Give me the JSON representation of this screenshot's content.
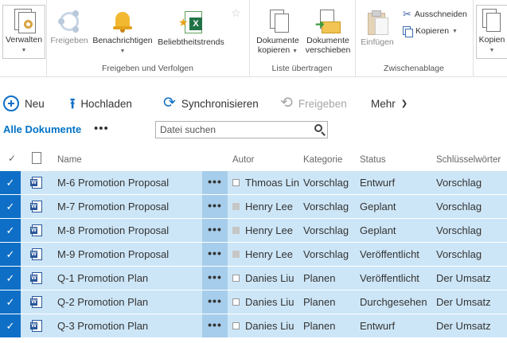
{
  "ribbon": {
    "manage": {
      "label": "Verwalten"
    },
    "share_group": {
      "label": "Freigeben und Verfolgen",
      "share": "Freigeben",
      "alerts": "Benachrichtigen",
      "trends": "Beliebtheitstrends"
    },
    "copy_group": {
      "label": "Liste übertragen",
      "copy_docs_1": "Dokumente",
      "copy_docs_2": "kopieren",
      "move_docs_1": "Dokumente",
      "move_docs_2": "verschieben"
    },
    "clipboard_group": {
      "label": "Zwischenablage",
      "paste": "Einfügen",
      "cut": "Ausschneiden",
      "copy": "Kopieren"
    },
    "copies": "Kopien"
  },
  "commands": {
    "new": "Neu",
    "upload": "Hochladen",
    "sync": "Synchronisieren",
    "share": "Freigeben",
    "more": "Mehr"
  },
  "view": {
    "name": "Alle Dokumente",
    "more": "•••",
    "search_placeholder": "Datei suchen"
  },
  "table": {
    "columns": {
      "name": "Name",
      "author": "Autor",
      "category": "Kategorie",
      "status": "Status",
      "keywords": "Schlüsselwörter"
    },
    "rows": [
      {
        "name": "M-6 Promotion Proposal",
        "author": "Thmoas Lin",
        "presence": "empty",
        "category": "Vorschlag",
        "status": "Entwurf",
        "keywords": "Vorschlag"
      },
      {
        "name": "M-7 Promotion Proposal",
        "author": "Henry Lee",
        "presence": "grey",
        "category": "Vorschlag",
        "status": "Geplant",
        "keywords": "Vorschlag"
      },
      {
        "name": "M-8 Promotion Proposal",
        "author": "Henry Lee",
        "presence": "grey",
        "category": "Vorschlag",
        "status": "Geplant",
        "keywords": "Vorschlag"
      },
      {
        "name": "M-9 Promotion Proposal",
        "author": "Henry Lee",
        "presence": "grey",
        "category": "Vorschlag",
        "status": "Veröffentlicht",
        "keywords": "Vorschlag"
      },
      {
        "name": "Q-1 Promotion Plan",
        "author": "Danies Liu",
        "presence": "empty",
        "category": "Planen",
        "status": "Veröffentlicht",
        "keywords": "Der Umsatz"
      },
      {
        "name": "Q-2 Promotion Plan",
        "author": "Danies Liu",
        "presence": "empty",
        "category": "Planen",
        "status": "Durchgesehen",
        "keywords": "Der Umsatz"
      },
      {
        "name": "Q-3 Promotion Plan",
        "author": "Danies Liu",
        "presence": "empty",
        "category": "Planen",
        "status": "Entwurf",
        "keywords": "Der Umsatz"
      }
    ]
  },
  "colors": {
    "accent": "#0f6fc6",
    "row_selected": "#cde6f7",
    "ellipsis_cell": "#a6cdeb",
    "link": "#0072c6"
  }
}
